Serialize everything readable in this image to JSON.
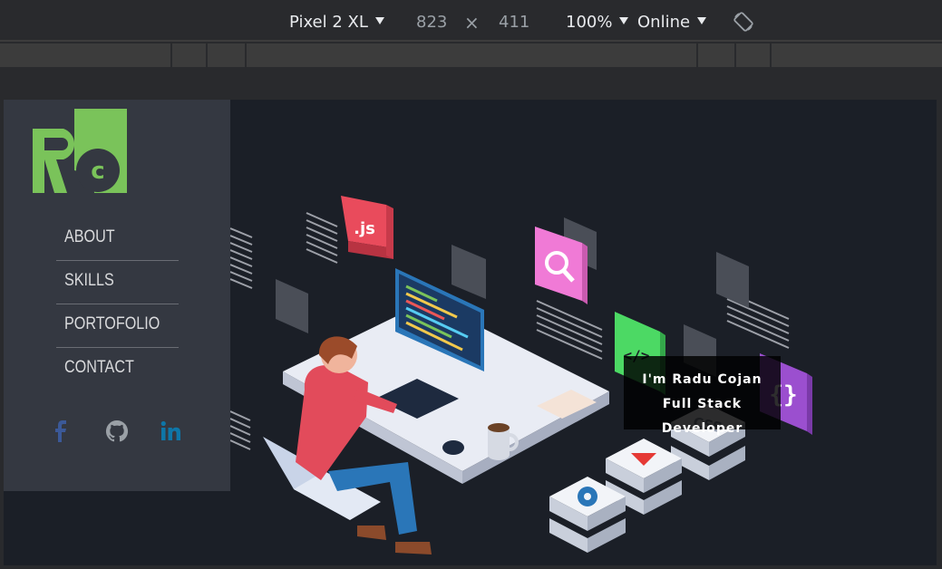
{
  "devtools": {
    "device": "Pixel 2 XL",
    "width": "823",
    "times": "×",
    "height": "411",
    "zoom": "100%",
    "network": "Online",
    "rotate_icon": "rotate-icon"
  },
  "sidebar": {
    "logo_text": "Rc",
    "nav": [
      "ABOUT",
      "SKILLS",
      "PORTOFOLIO",
      "CONTACT"
    ],
    "social": [
      {
        "icon": "facebook-icon",
        "color": "#3b5998"
      },
      {
        "icon": "github-icon",
        "color": "#9aa0a6"
      },
      {
        "icon": "linkedin-icon",
        "color": "#0e76a8"
      }
    ]
  },
  "hero": {
    "line1": "I'm Radu Cojan",
    "line2": "Full Stack Developer",
    "icons": [
      "js-icon",
      "search-icon",
      "code-icon",
      "braces-icon",
      "css-icon",
      "play-icon",
      "gear-icon"
    ]
  },
  "colors": {
    "accent_green": "#7ac35a",
    "sidebar_bg": "#343841",
    "hero_bg": "#1b1f27"
  }
}
